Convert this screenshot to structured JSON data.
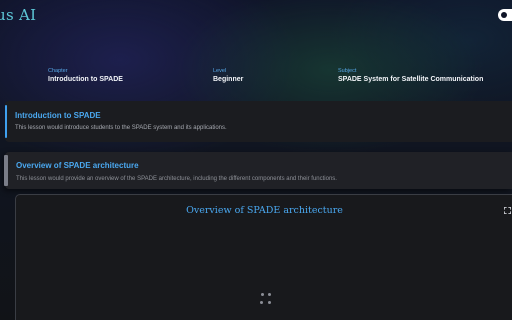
{
  "header": {
    "brand": "us AI",
    "theme_toggle_icon": "theme-toggle-icon"
  },
  "meta": {
    "chapter_label": "Chapter",
    "chapter_value": "Introduction to SPADE",
    "level_label": "Level",
    "level_value": "Beginner",
    "subject_label": "Subject",
    "subject_value": "SPADE System for Satellite Communication"
  },
  "lessons": [
    {
      "title": "Introduction to SPADE",
      "description": "This lesson would introduce students to the SPADE system and its applications."
    },
    {
      "title": "Overview of SPADE architecture",
      "description": "This lesson would provide an overview of the SPADE architecture, including the different components and their functions."
    }
  ],
  "viewer": {
    "title": "Overview of SPADE architecture",
    "expand_icon": "expand-icon",
    "loading_icon": "loading-spinner-icon"
  },
  "colors": {
    "accent": "#4aa8f0",
    "brand": "#5ec8d8",
    "card_bg": "#1b1c20"
  }
}
